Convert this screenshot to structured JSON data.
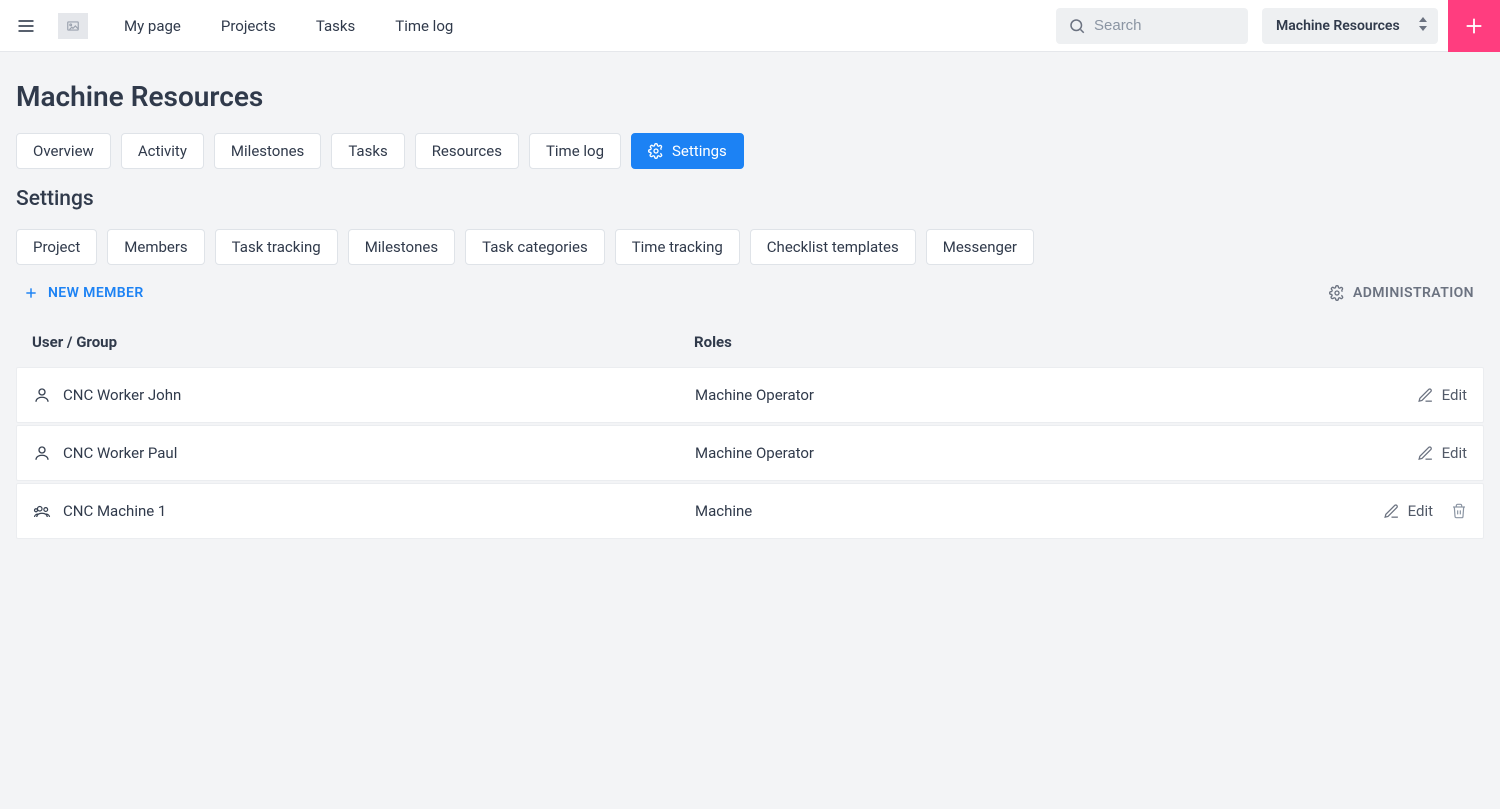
{
  "header": {
    "nav": [
      "My page",
      "Projects",
      "Tasks",
      "Time log"
    ],
    "search_placeholder": "Search",
    "project_selector": "Machine Resources"
  },
  "page": {
    "title": "Machine Resources",
    "tabs": [
      "Overview",
      "Activity",
      "Milestones",
      "Tasks",
      "Resources",
      "Time log",
      "Settings"
    ],
    "active_tab_index": 6,
    "section_title": "Settings",
    "subtabs": [
      "Project",
      "Members",
      "Task tracking",
      "Milestones",
      "Task categories",
      "Time tracking",
      "Checklist templates",
      "Messenger"
    ],
    "new_member_label": "NEW MEMBER",
    "administration_label": "ADMINISTRATION",
    "table": {
      "head_user": "User / Group",
      "head_roles": "Roles",
      "edit_label": "Edit",
      "rows": [
        {
          "icon": "user",
          "name": "CNC Worker John",
          "role": "Machine Operator",
          "deletable": false
        },
        {
          "icon": "user",
          "name": "CNC Worker Paul",
          "role": "Machine Operator",
          "deletable": false
        },
        {
          "icon": "group",
          "name": "CNC Machine 1",
          "role": "Machine",
          "deletable": true
        }
      ]
    }
  }
}
